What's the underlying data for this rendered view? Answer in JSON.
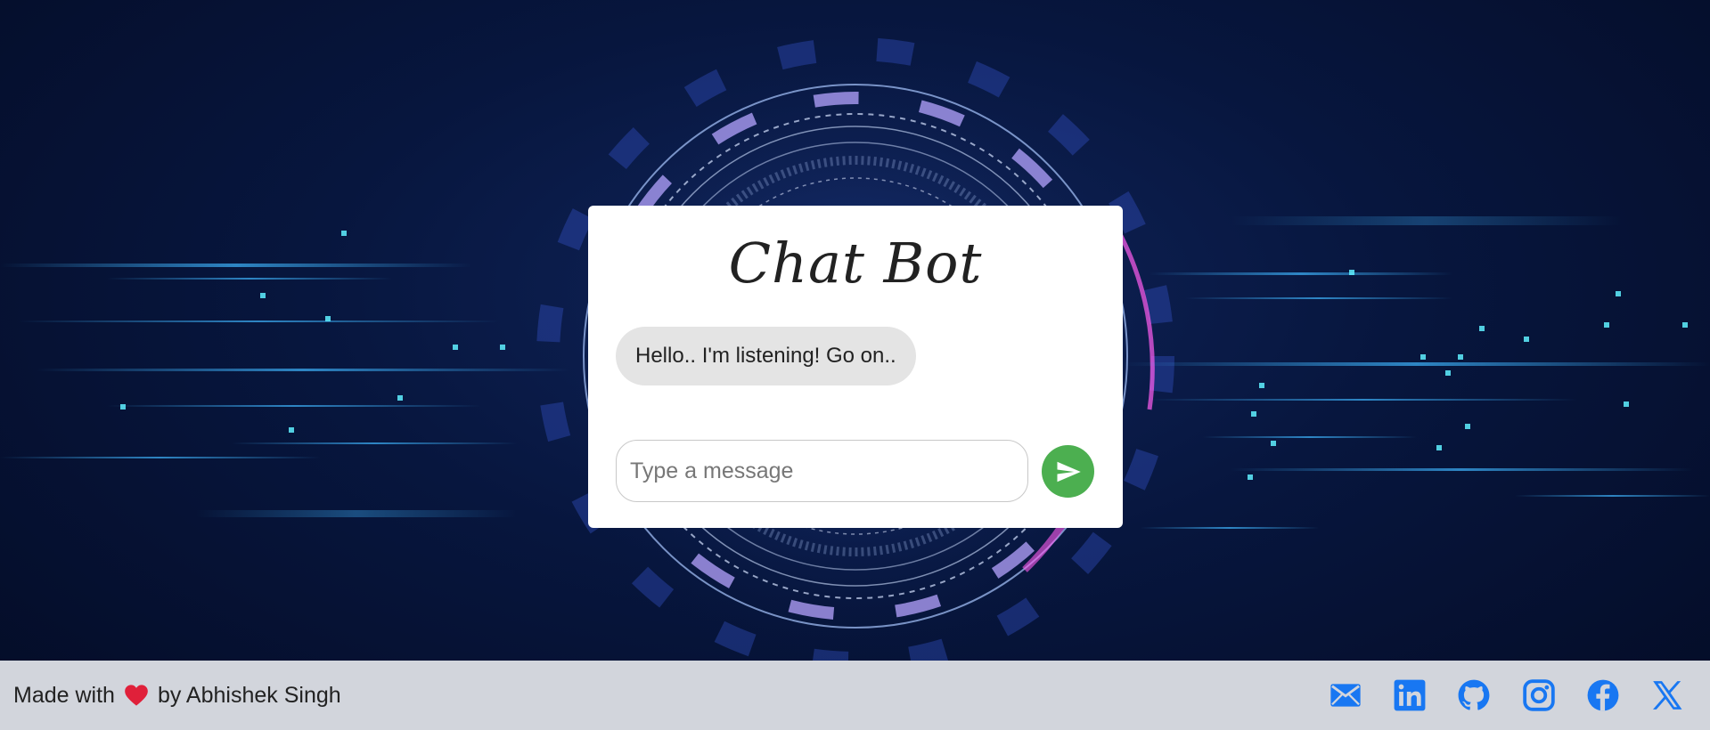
{
  "chat": {
    "title": "Chat Bot",
    "bot_message": "Hello.. I'm listening! Go on..",
    "input_placeholder": "Type a message",
    "input_value": ""
  },
  "footer": {
    "made_with": "Made with",
    "by_author": "by Abhishek Singh"
  },
  "icons": {
    "send": "send-icon",
    "heart": "heart-icon",
    "social": [
      "email-icon",
      "linkedin-icon",
      "github-icon",
      "instagram-icon",
      "facebook-icon",
      "x-icon"
    ]
  },
  "colors": {
    "send_button": "#4caf50",
    "social_icons": "#1877f2",
    "heart": "#e0203a",
    "bot_bubble": "#e4e4e4",
    "footer_bg": "#d2d5dc"
  }
}
